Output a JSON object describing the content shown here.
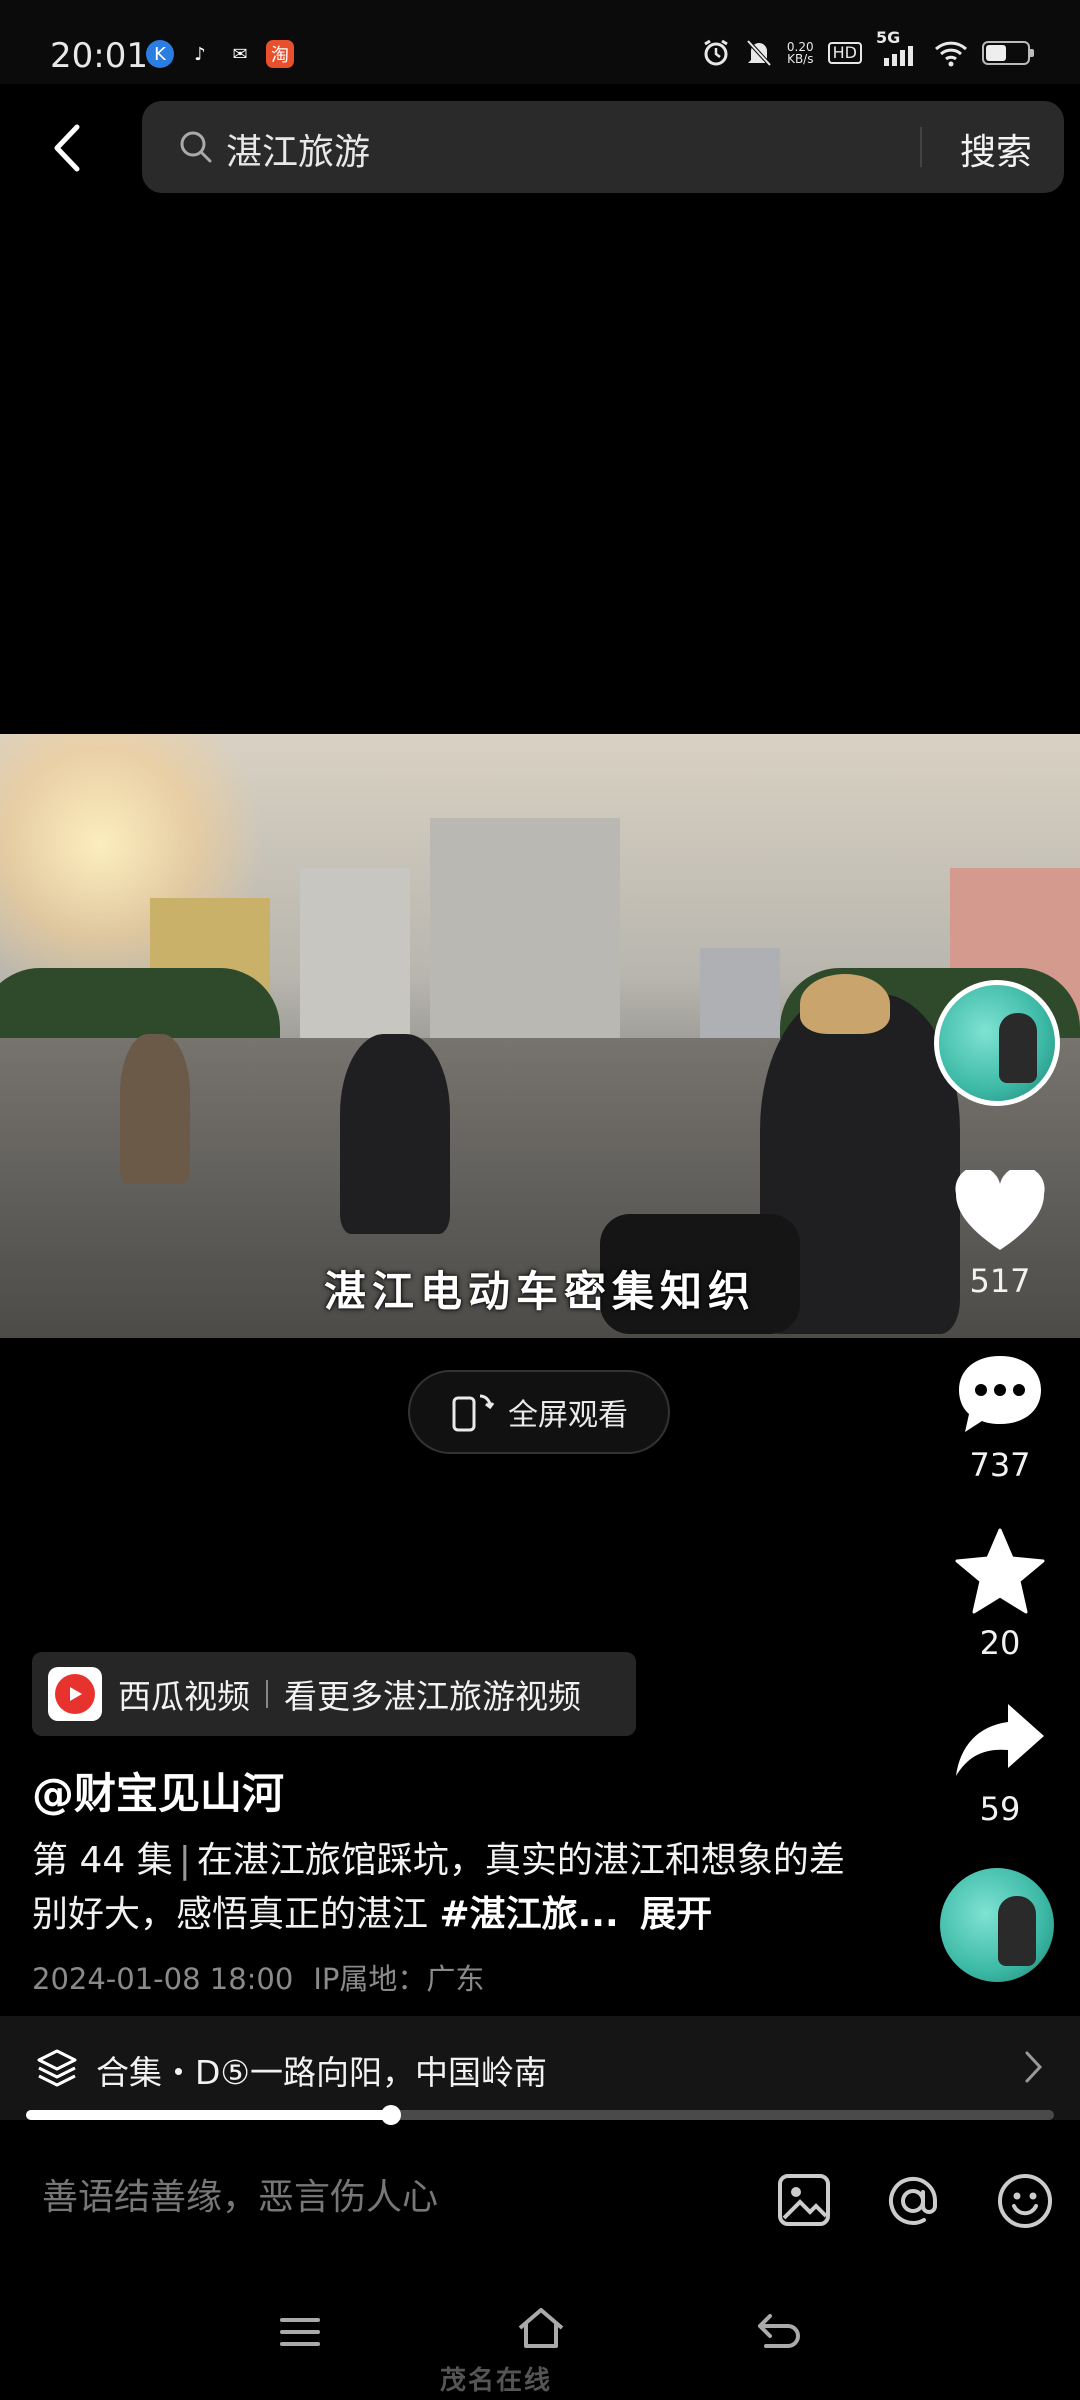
{
  "status_bar": {
    "time": "20:01",
    "net_speed_value": "0.20",
    "net_speed_unit": "KB/s",
    "hd": "HD",
    "network": "5G",
    "battery_level": 0.55
  },
  "search": {
    "query": "湛江旅游",
    "button": "搜索"
  },
  "video": {
    "subtitle": "湛江电动车密集知织",
    "fullscreen_label": "全屏观看"
  },
  "actions": {
    "likes": "517",
    "comments": "737",
    "favorites": "20",
    "shares": "59"
  },
  "xigua": {
    "name": "西瓜视频",
    "cta": "看更多湛江旅游视频"
  },
  "post": {
    "author": "@财宝见山河",
    "episode": "第 44 集",
    "description": "在湛江旅馆踩坑，真实的湛江和想象的差别好大，感悟真正的湛江",
    "hashtag": "#湛江旅...",
    "expand": "展开",
    "date": "2024-01-08 18:00",
    "ip_location": "IP属地：广东"
  },
  "collection": {
    "label": "合集・D⑤一路向阳，中国岭南"
  },
  "progress": {
    "fraction": 0.355
  },
  "comment": {
    "placeholder": "善语结善缘，恶言伤人心"
  },
  "watermark": "茂名在线",
  "colors": {
    "background": "#000000",
    "search_bg": "#2a2a2a",
    "xigua_red": "#e8322d"
  }
}
